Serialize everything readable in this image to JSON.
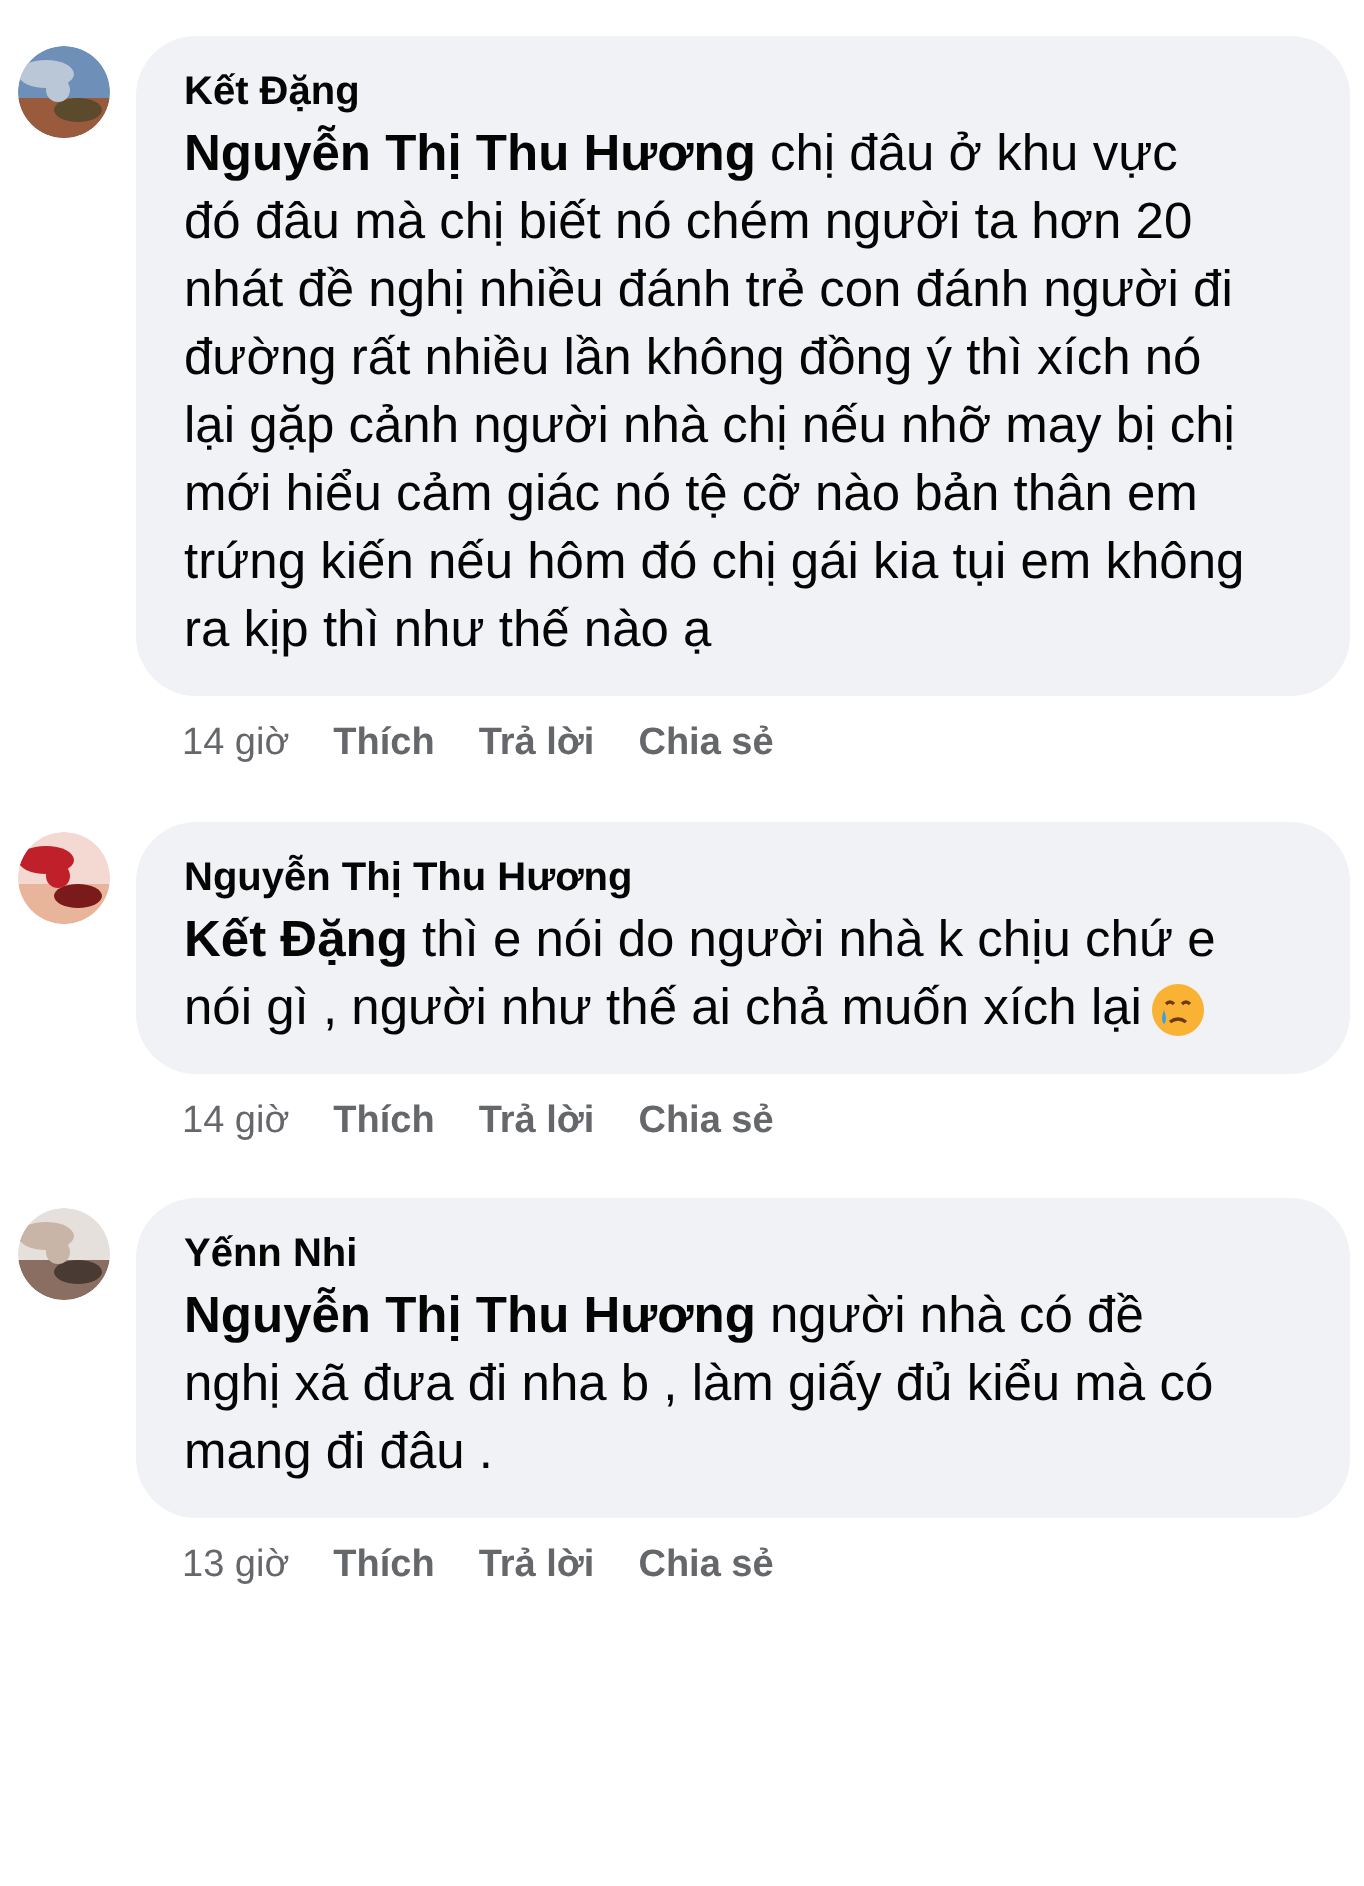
{
  "comments": [
    {
      "author": "Kết Đặng",
      "mention": "Nguyễn Thị Thu Hương",
      "text": "chị đâu ở khu vực đó đâu mà chị biết nó chém người ta hơn 20 nhát đề nghị nhiều đánh trẻ con đánh người đi đường rất nhiều lần không đồng ý thì xích nó lại gặp cảnh người nhà chị nếu nhỡ may bị chị mới hiểu cảm giác nó tệ cỡ nào bản thân em trứng kiến nếu hôm đó chị gái kia tụi em không ra kịp thì như thế nào ạ",
      "time": "14 giờ",
      "actions": [
        "Thích",
        "Trả lời",
        "Chia sẻ"
      ]
    },
    {
      "author": "Nguyễn Thị Thu Hương",
      "mention": "Kết Đặng",
      "text": "thì e nói do người nhà k chịu chứ e nói gì , người như thế ai chả muốn xích lại",
      "emoji": true,
      "time": "14 giờ",
      "actions": [
        "Thích",
        "Trả lời",
        "Chia sẻ"
      ]
    },
    {
      "author": "Yếnn Nhi",
      "mention": "Nguyễn Thị Thu Hương",
      "text": "người nhà có đề nghị xã đưa đi nha b , làm giấy đủ kiểu mà có mang đi đâu .",
      "time": "13 giờ",
      "actions": [
        "Thích",
        "Trả lời",
        "Chia sẻ"
      ]
    }
  ]
}
